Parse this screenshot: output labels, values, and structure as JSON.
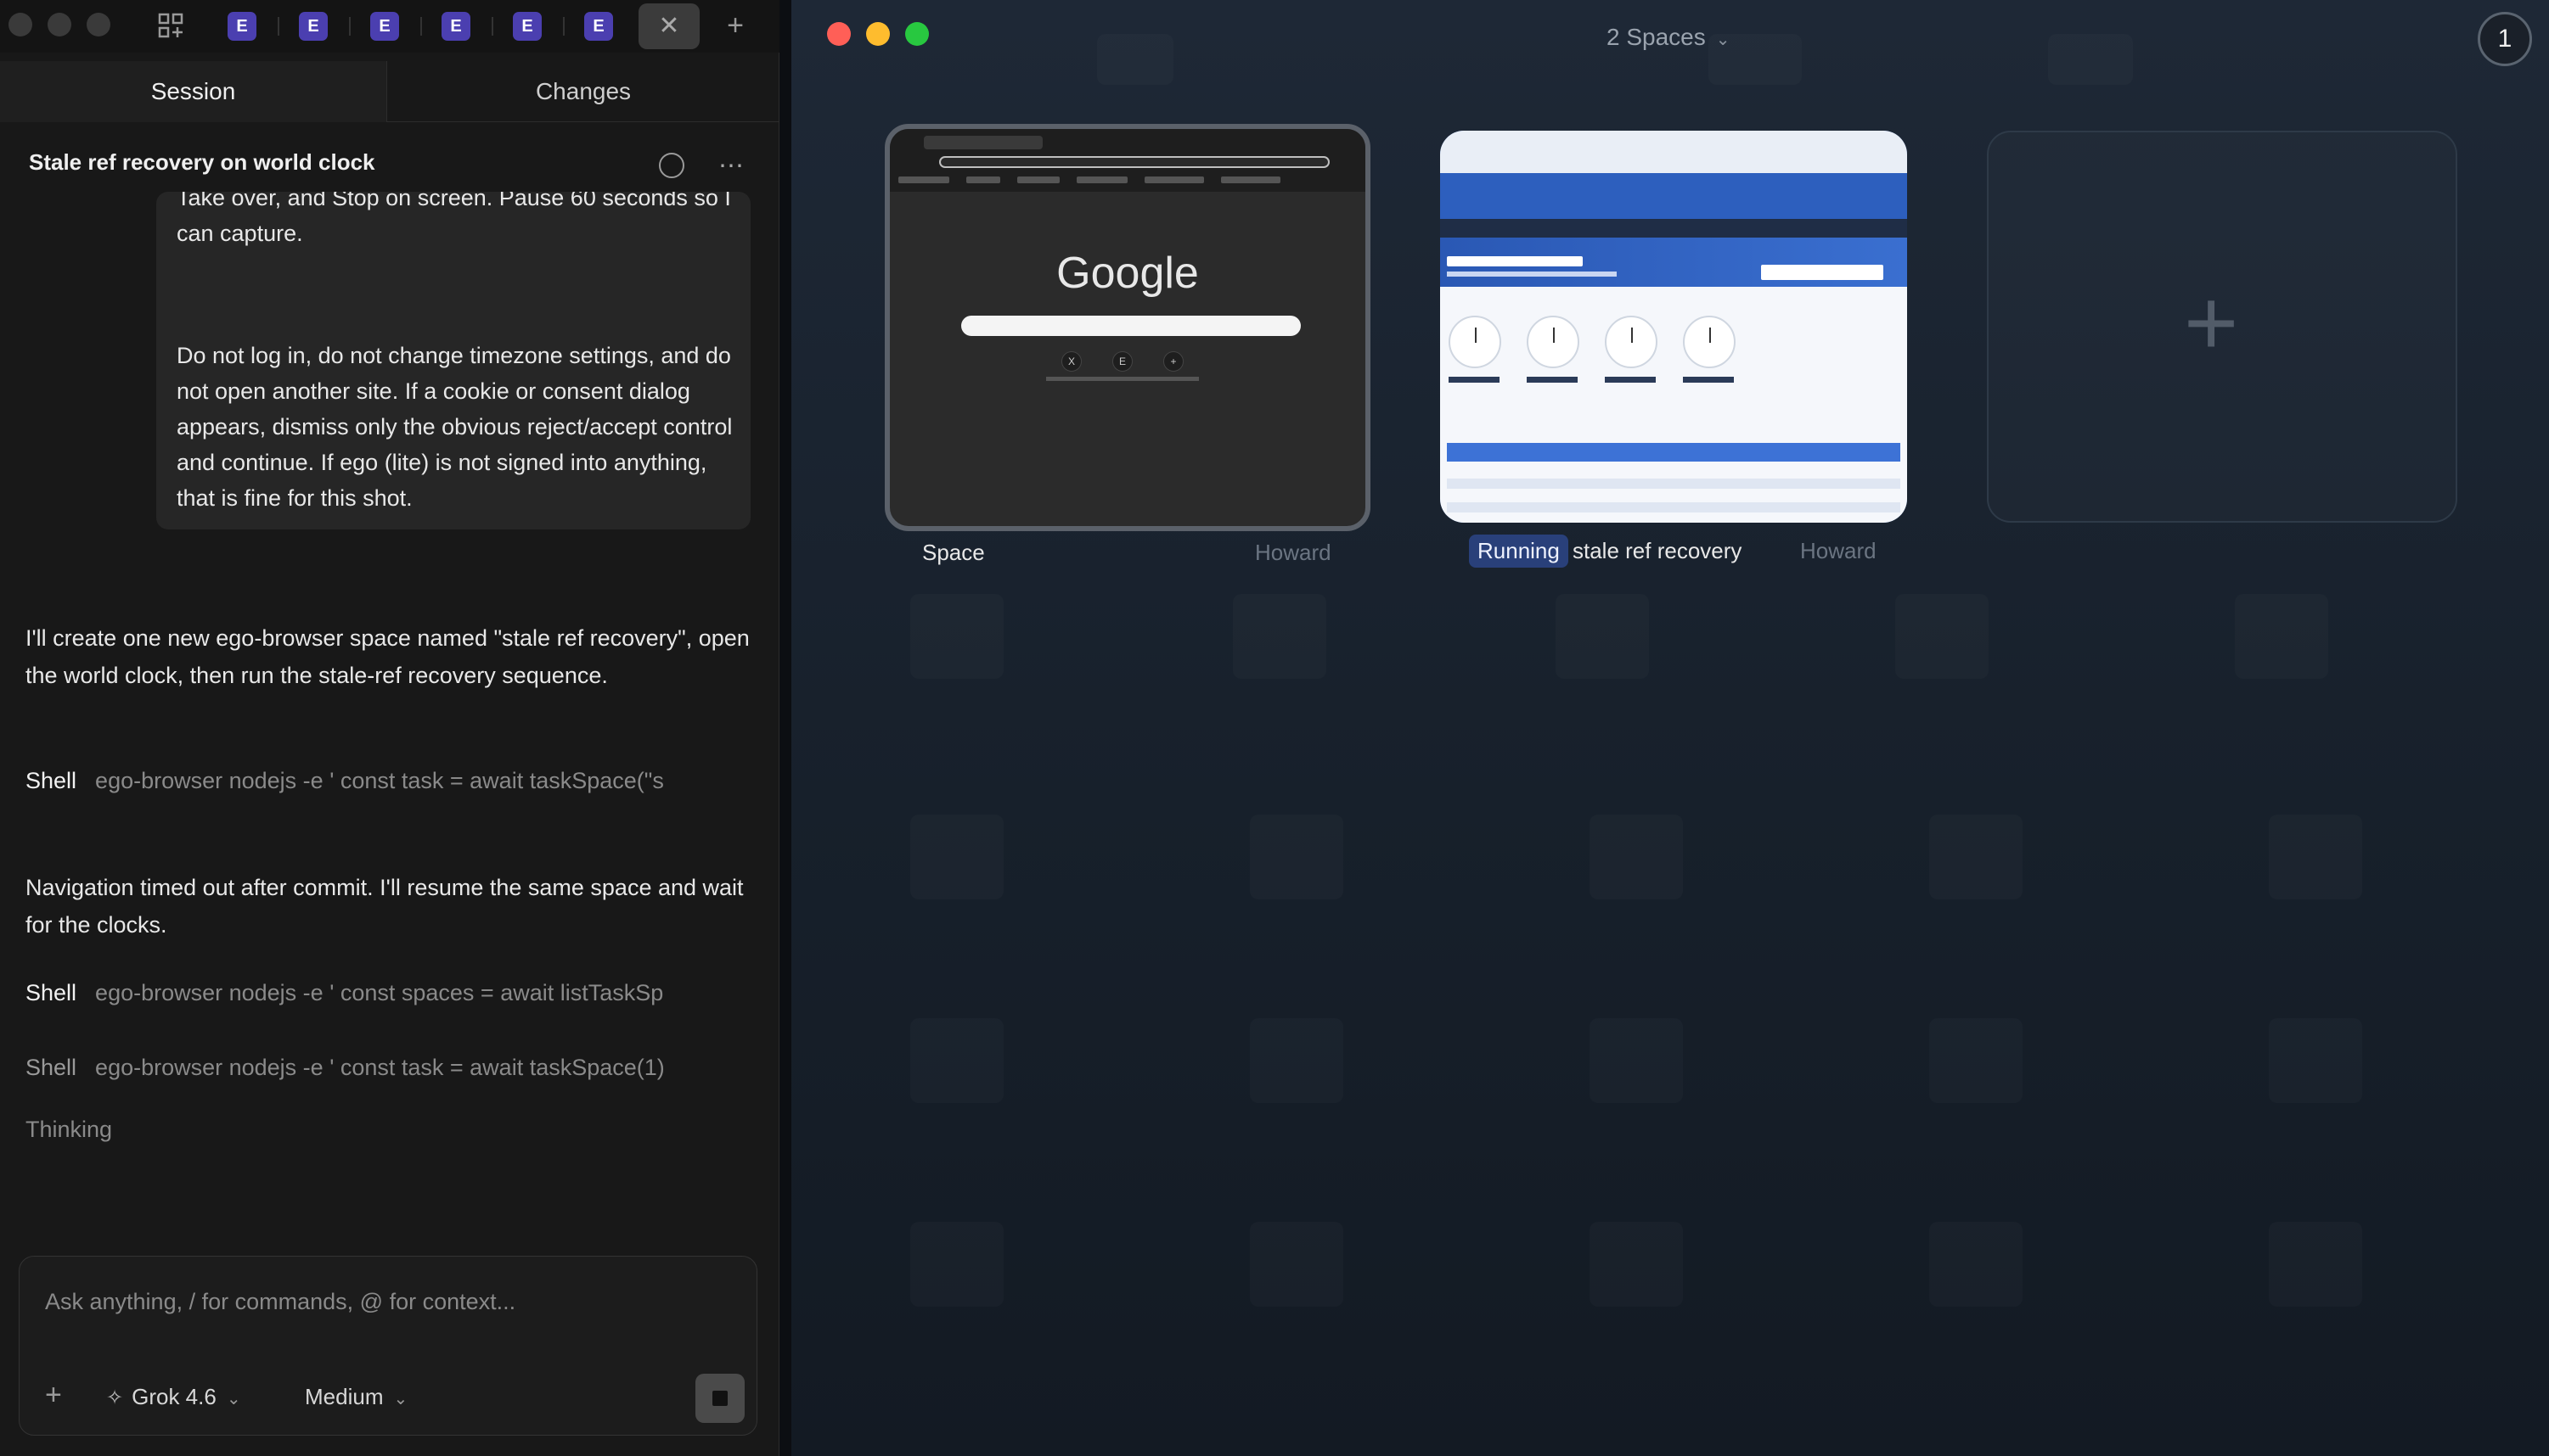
{
  "topbar": {
    "tabs": [
      "E",
      "E",
      "E",
      "E",
      "E",
      "E"
    ],
    "close_glyph": "✕",
    "add_glyph": "+"
  },
  "panel": {
    "segments": {
      "session": "Session",
      "changes": "Changes"
    },
    "session_title": "Stale ref recovery on world clock",
    "user_bubble": {
      "p1": "Take over, and Stop on screen. Pause 60 seconds so I can capture.",
      "p2": "Do not log in, do not change timezone settings, and do not open another site. If a cookie or consent dialog appears, dismiss only the obvious reject/accept control and continue. If ego (lite) is not signed into anything, that is fine for this shot."
    },
    "messages": [
      "I'll create one new ego-browser space named \"stale ref recovery\", open the world clock, then run the stale-ref recovery sequence.",
      "Navigation timed out after commit. I'll resume the same space and wait for the clocks."
    ],
    "shells": [
      {
        "label": "Shell",
        "cmd": "ego-browser nodejs -e ' const task = await taskSpace(\"s"
      },
      {
        "label": "Shell",
        "cmd": "ego-browser nodejs -e ' const spaces = await listTaskSp"
      },
      {
        "label": "Shell",
        "cmd": "ego-browser nodejs -e ' const task = await taskSpace(1)"
      }
    ],
    "thinking": "Thinking"
  },
  "composer": {
    "placeholder": "Ask anything, / for commands, @ for context...",
    "add_glyph": "+",
    "model": "Grok 4.6",
    "effort": "Medium"
  },
  "spaces": {
    "title": "2 Spaces",
    "count": "1",
    "cards": [
      {
        "name": "Space",
        "owner": "Howard",
        "status": "",
        "preview": {
          "logo": "Google"
        }
      },
      {
        "name": "stale ref recovery",
        "owner": "Howard",
        "status": "Running"
      }
    ],
    "add_glyph": "+"
  },
  "colors": {
    "tab_accent": "#4b3fb0",
    "running_badge": "#29407a",
    "traffic_close": "#ff5f57",
    "traffic_min": "#febc2e",
    "traffic_max": "#28c840"
  },
  "icons": [
    "grid-icon",
    "close-icon",
    "plus-icon",
    "circle-icon",
    "more-icon",
    "sparkle-icon",
    "chevron-down-icon",
    "stop-icon"
  ]
}
